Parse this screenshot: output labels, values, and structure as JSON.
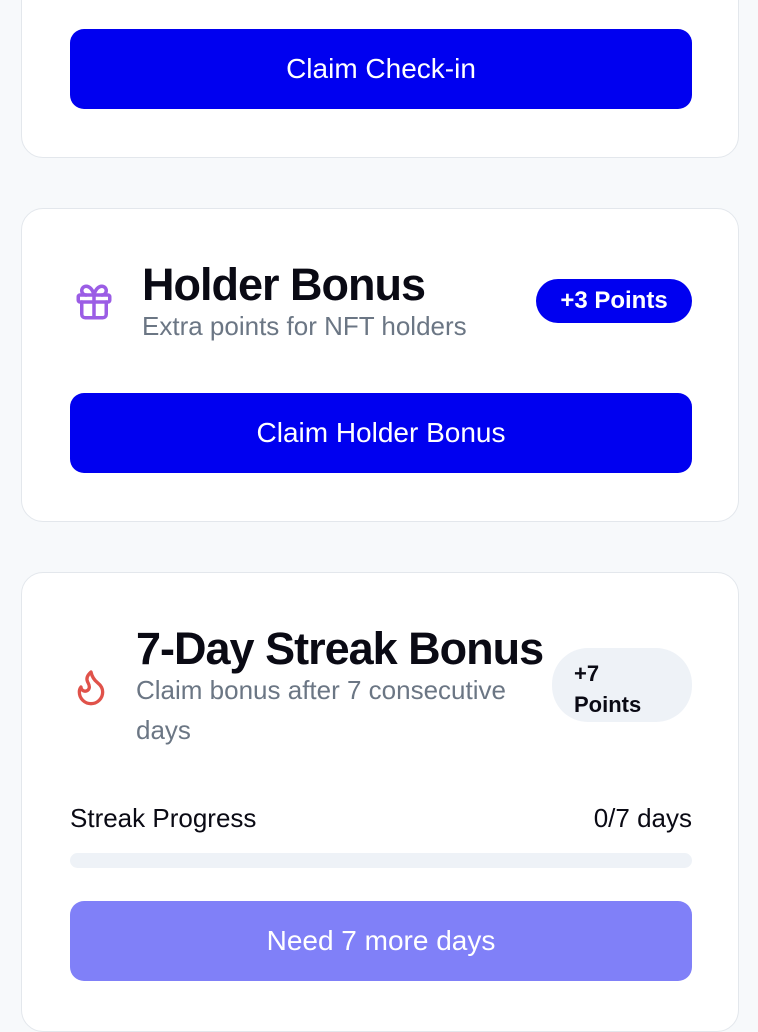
{
  "checkin_card": {
    "button_label": "Claim Check-in"
  },
  "holder_card": {
    "icon": "gift-icon",
    "icon_color": "#9b5de5",
    "title": "Holder Bonus",
    "subtitle": "Extra points for NFT holders",
    "badge": "+3 Points",
    "button_label": "Claim Holder Bonus"
  },
  "streak_card": {
    "icon": "flame-icon",
    "icon_color": "#e0524a",
    "title": "7-Day Streak Bonus",
    "subtitle": "Claim bonus after 7 consecutive days",
    "badge": "+7 Points",
    "progress_label": "Streak Progress",
    "progress_value": "0/7 days",
    "progress_fraction": 0,
    "button_label": "Need 7 more days"
  },
  "colors": {
    "primary": "#0000f0",
    "primary_disabled": "#8080f8",
    "card_border": "#e3e7ec",
    "page_background": "#f7f9fb"
  }
}
